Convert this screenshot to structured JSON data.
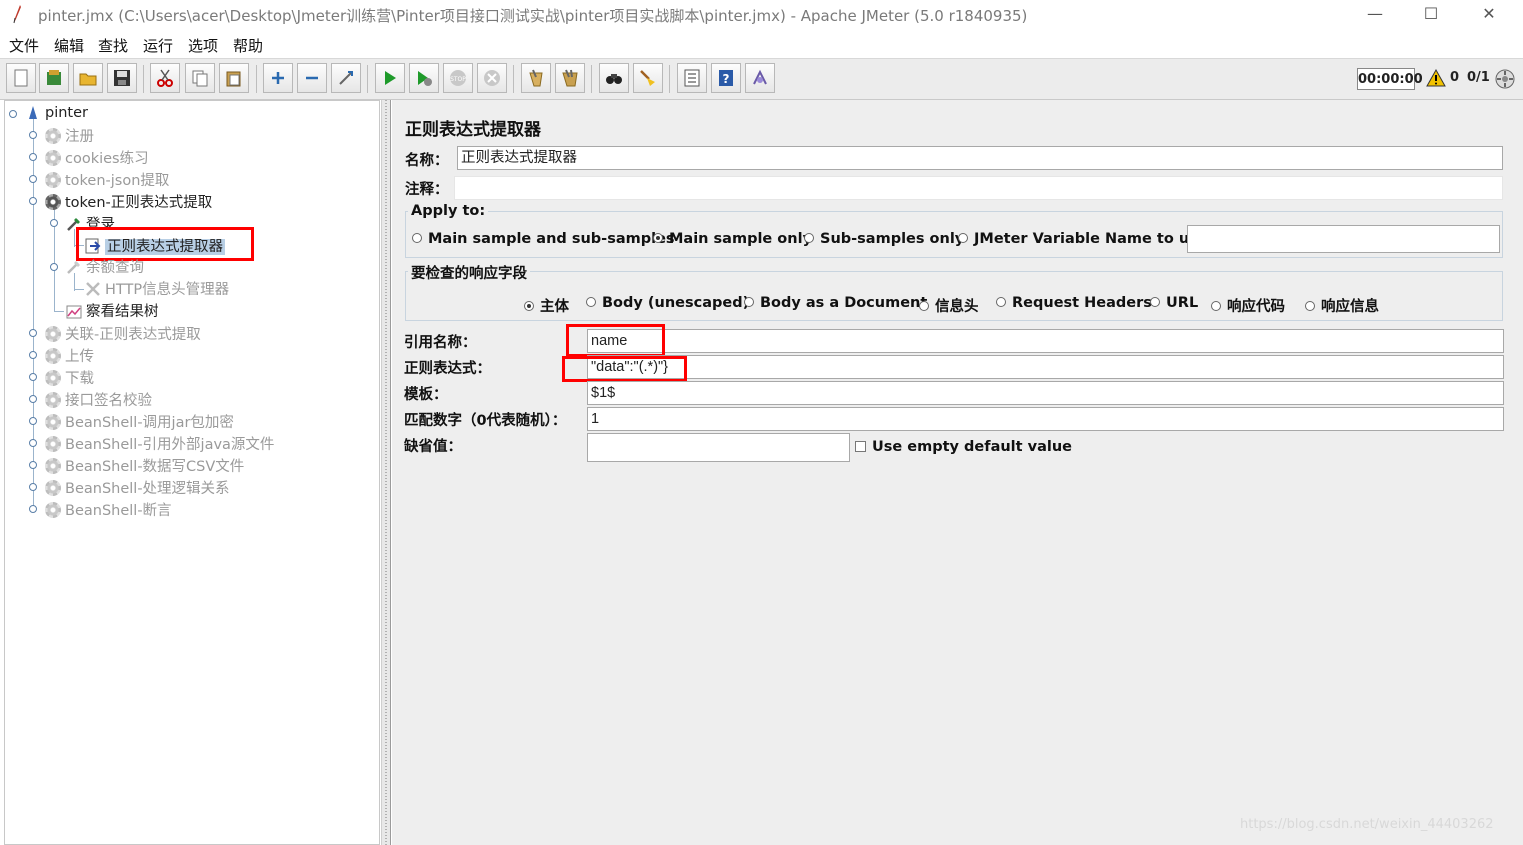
{
  "window": {
    "title": "pinter.jmx (C:\\Users\\acer\\Desktop\\Jmeter训练营\\Pinter项目接口测试实战\\pinter项目实战脚本\\pinter.jmx) - Apache JMeter (5.0 r1840935)",
    "minimize": "—",
    "maximize": "☐",
    "close": "✕"
  },
  "menu": [
    "文件",
    "编辑",
    "查找",
    "运行",
    "选项",
    "帮助"
  ],
  "toolbar": {
    "buttons": [
      "new-icon",
      "templates-icon",
      "open-icon",
      "save-icon",
      "cut-icon",
      "copy-icon",
      "paste-icon",
      "expand-icon",
      "collapse-icon",
      "toggle-icon",
      "start-icon",
      "start-no-pause-icon",
      "stop-icon",
      "shutdown-icon",
      "clear-icon",
      "clear-all-icon",
      "search-icon",
      "reset-search-icon",
      "function-helper-icon",
      "help-icon",
      "remote-icon"
    ],
    "timer": "00:00:00",
    "warnings": "0",
    "threads": "0/1"
  },
  "tree": {
    "root": "pinter",
    "nodes": [
      {
        "label": "注册",
        "disabled": true
      },
      {
        "label": "cookies练习",
        "disabled": true
      },
      {
        "label": "token-json提取",
        "disabled": true
      },
      {
        "label": "token-正则表达式提取",
        "disabled": false
      },
      {
        "label": "登录",
        "disabled": false
      },
      {
        "label": "正则表达式提取器",
        "disabled": false
      },
      {
        "label": "余额查询",
        "disabled": true
      },
      {
        "label": "HTTP信息头管理器",
        "disabled": true
      },
      {
        "label": "察看结果树",
        "disabled": false
      },
      {
        "label": "关联-正则表达式提取",
        "disabled": true
      },
      {
        "label": "上传",
        "disabled": true
      },
      {
        "label": "下载",
        "disabled": true
      },
      {
        "label": "接口签名校验",
        "disabled": true
      },
      {
        "label": "BeanShell-调用jar包加密",
        "disabled": true
      },
      {
        "label": "BeanShell-引用外部java源文件",
        "disabled": true
      },
      {
        "label": "BeanShell-数据写CSV文件",
        "disabled": true
      },
      {
        "label": "BeanShell-处理逻辑关系",
        "disabled": true
      },
      {
        "label": "BeanShell-断言",
        "disabled": true
      }
    ]
  },
  "panel": {
    "heading": "正则表达式提取器",
    "name_label": "名称：",
    "name_value": "正则表达式提取器",
    "comment_label": "注释：",
    "comment_value": "",
    "apply_to": {
      "title": "Apply to:",
      "options": [
        "Main sample and sub-samples",
        "Main sample only",
        "Sub-samples only",
        "JMeter Variable Name to use"
      ],
      "selected": "Main sample only",
      "variable_value": ""
    },
    "field_to_check": {
      "title": "要检查的响应字段",
      "options": [
        "主体",
        "Body (unescaped)",
        "Body as a Document",
        "信息头",
        "Request Headers",
        "URL",
        "响应代码",
        "响应信息"
      ],
      "selected": "主体"
    },
    "ref_name_label": "引用名称：",
    "ref_name_value": "name",
    "regex_label": "正则表达式：",
    "regex_value": "\"data\":\"(.*)\"}",
    "template_label": "模板：",
    "template_value": "$1$",
    "match_label": "匹配数字（0代表随机）：",
    "match_value": "1",
    "default_label": "缺省值：",
    "default_value": "",
    "use_empty_label": "Use empty default value"
  },
  "watermark": "https://blog.csdn.net/weixin_44403262"
}
